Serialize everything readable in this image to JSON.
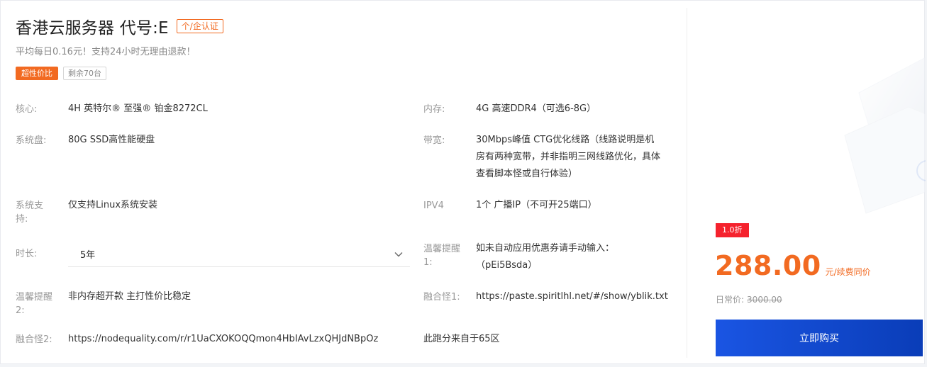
{
  "product": {
    "title": "香港云服务器 代号:E",
    "verify_tag": "个/企认证",
    "subtitle": "平均每日0.16元！支持24小时无理由退款！",
    "badge_hot": "超性价比",
    "badge_stock": "剩余70台"
  },
  "specs": {
    "core_label": "核心:",
    "core_value": "4H 英特尔® 至强® 铂金8272CL",
    "mem_label": "内存:",
    "mem_value": "4G 高速DDR4（可选6-8G）",
    "disk_label": "系统盘:",
    "disk_value": "80G SSD高性能硬盘",
    "bw_label": "带宽:",
    "bw_value_1": "30Mbps峰值 CTG优化线路（线路说明是机",
    "bw_value_2": "房有两种宽带，并非指明三网线路优化，具体",
    "bw_value_3": "查看脚本怪或自行体验）",
    "os_label_1": "系统支",
    "os_label_2": "持:",
    "os_value": "仅支持Linux系统安装",
    "ipv4_label": "IPV4",
    "ipv4_value": "1个 广播IP（不可开25端口）",
    "duration_label": "时长:",
    "duration_value": "5年",
    "tip1_label_1": "温馨提醒",
    "tip1_label_2": "1:",
    "tip1_value_1": "如未自动应用优惠券请手动输入：",
    "tip1_value_2": "（pEi5Bsda）",
    "tip2_label_1": "温馨提醒",
    "tip2_label_2": "2:",
    "tip2_value": "非内存超开款 主打性价比稳定",
    "merge1_label": "融合怪1:",
    "merge1_value": "https://paste.spiritlhl.net/#/show/yblik.txt",
    "merge2_label": "融合怪2:",
    "merge2_value": "https://nodequality.com/r/r1UaCXOKOQQmon4HbIAvLzxQHJdNBpOz",
    "note": "此跑分来自于65区"
  },
  "pricing": {
    "discount": "1.0折",
    "price": "288.00",
    "unit": "元/续费同价",
    "orig_label": "日常价:",
    "orig_price": "3000.00",
    "buy_label": "立即购买"
  },
  "colors": {
    "accent": "#f26a21",
    "discount_red": "#f5222d",
    "button_blue": "#1a55e3"
  }
}
